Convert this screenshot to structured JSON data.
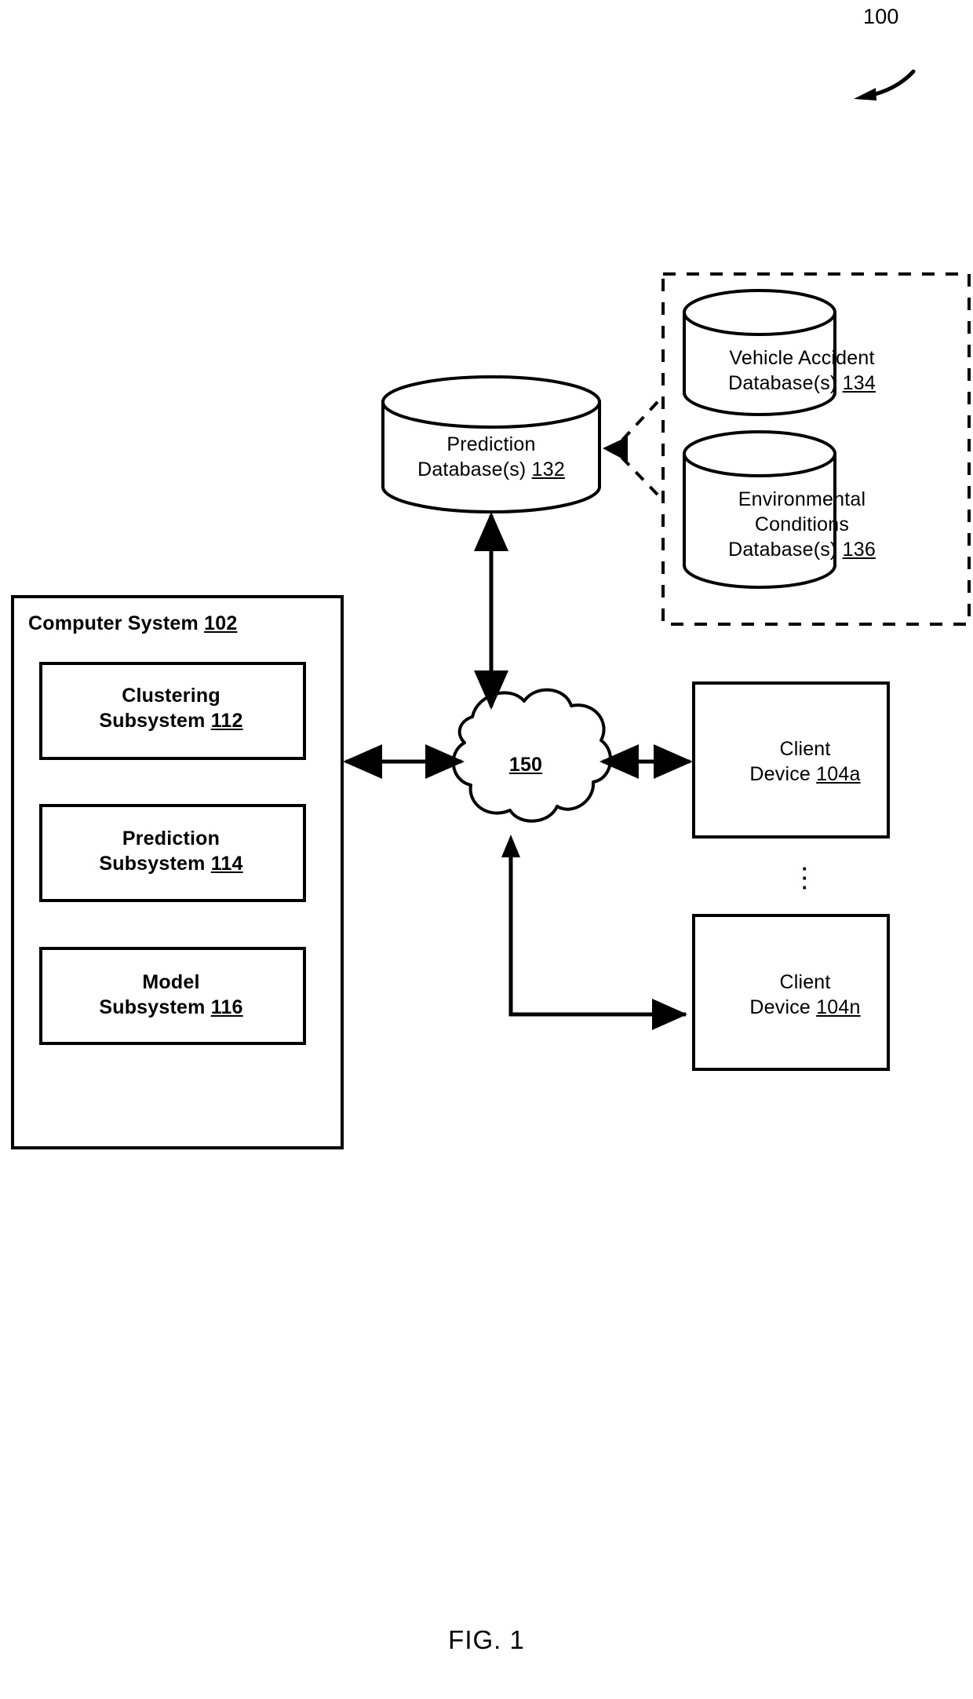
{
  "figure": {
    "caption": "FIG. 1",
    "callout_ref": "100",
    "stroke_color": "#000000",
    "background_color": "#ffffff"
  },
  "databases": {
    "prediction": {
      "line1": "Prediction",
      "line2": "Database(s)",
      "ref": "132"
    },
    "vehicle_accident": {
      "line1": "Vehicle Accident",
      "line2": "Database(s)",
      "ref": "134"
    },
    "environmental_conditions": {
      "line1": "Environmental",
      "line2": "Conditions",
      "line3": "Database(s)",
      "ref": "136"
    }
  },
  "computer_system": {
    "title": "Computer System",
    "ref": "102",
    "subsystems": [
      {
        "line1": "Clustering",
        "line2": "Subsystem",
        "ref": "112"
      },
      {
        "line1": "Prediction",
        "line2": "Subsystem",
        "ref": "114"
      },
      {
        "line1": "Model",
        "line2": "Subsystem",
        "ref": "116"
      }
    ]
  },
  "network": {
    "ref": "150",
    "icon": "cloud-icon"
  },
  "clients": [
    {
      "line1": "Client",
      "line2": "Device",
      "ref": "104a"
    },
    {
      "line1": "Client",
      "line2": "Device",
      "ref": "104n"
    }
  ],
  "ellipsis": {
    "dot": "·"
  },
  "icons": {
    "callout_arrow": "curved-arrow-icon",
    "cylinder": "database-cylinder-icon",
    "double_arrow": "double-headed-arrow-icon",
    "dashed_group": "dashed-group-border"
  }
}
